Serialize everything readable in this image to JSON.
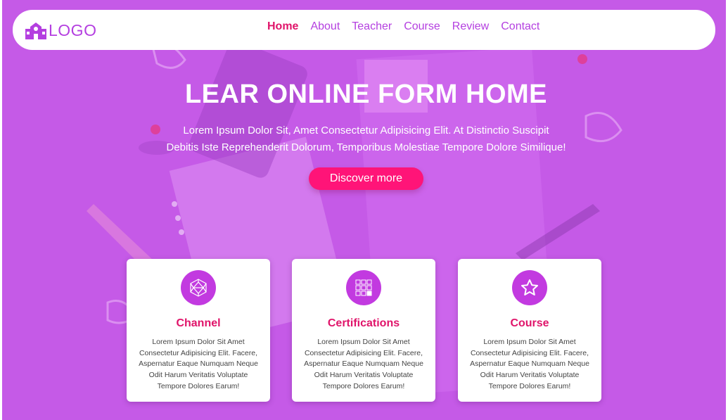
{
  "colors": {
    "hero_background": "#c55ae7",
    "accent_purple": "#b43fe0",
    "accent_pink": "#e0146a",
    "button_pink": "#ff1478",
    "icon_circle": "#c23ae0"
  },
  "header": {
    "logo_icon": "school-building-icon",
    "logo_text": "LOGO",
    "nav": [
      "Home",
      "About",
      "Teacher",
      "Course",
      "Review",
      "Contact"
    ]
  },
  "hero": {
    "title": "LEAR ONLINE FORM HOME",
    "subtitle_line1": "Lorem Ipsum Dolor Sit, Amet Consectetur Adipisicing Elit. At Distinctio Suscipit",
    "subtitle_line2": "Debitis Iste Reprehenderit Dolorum, Temporibus Molestiae Tempore Dolore Similique!",
    "button": "Discover more"
  },
  "cards": [
    {
      "icon": "polyhedron-icon",
      "title": "Channel",
      "text": "Lorem Ipsum Dolor Sit Amet Consectetur Adipisicing Elit. Facere, Aspernatur Eaque Numquam Neque Odit Harum Veritatis Voluptate Tempore Dolores Earum!"
    },
    {
      "icon": "grid-icon",
      "title": "Certifications",
      "text": "Lorem Ipsum Dolor Sit Amet Consectetur Adipisicing Elit. Facere, Aspernatur Eaque Numquam Neque Odit Harum Veritatis Voluptate Tempore Dolores Earum!"
    },
    {
      "icon": "star-icon",
      "title": "Course",
      "text": "Lorem Ipsum Dolor Sit Amet Consectetur Adipisicing Elit. Facere, Aspernatur Eaque Numquam Neque Odit Harum Veritatis Voluptate Tempore Dolores Earum!"
    }
  ]
}
